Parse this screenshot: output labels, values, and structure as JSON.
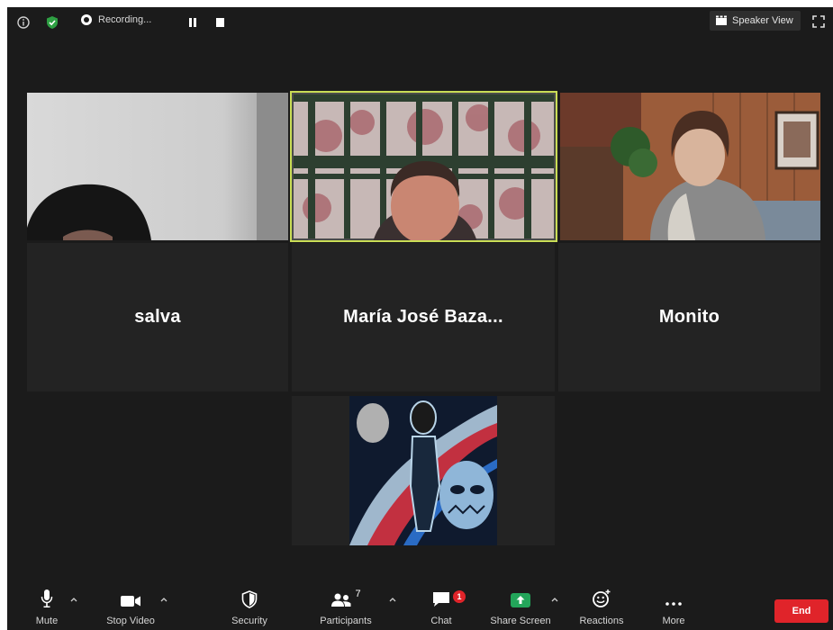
{
  "top_bar": {
    "recording_label": "Recording...",
    "speaker_view_label": "Speaker View"
  },
  "participants": [
    {
      "name": "salva",
      "video": "on"
    },
    {
      "name": "María José Baza...",
      "video": "on",
      "speaking": true
    },
    {
      "name": "Monito",
      "video": "on"
    },
    {
      "name": "",
      "video": "profile-picture"
    }
  ],
  "toolbar": {
    "mute_label": "Mute",
    "stop_video_label": "Stop Video",
    "security_label": "Security",
    "participants_label": "Participants",
    "participants_count": "7",
    "chat_label": "Chat",
    "chat_badge": "1",
    "share_screen_label": "Share Screen",
    "reactions_label": "Reactions",
    "more_label": "More",
    "end_label": "End"
  },
  "colors": {
    "background": "#1b1b1b",
    "tile": "#232323",
    "active_speaker_border": "#c9dd55",
    "share_green": "#23a55a",
    "end_red": "#e0242a"
  }
}
